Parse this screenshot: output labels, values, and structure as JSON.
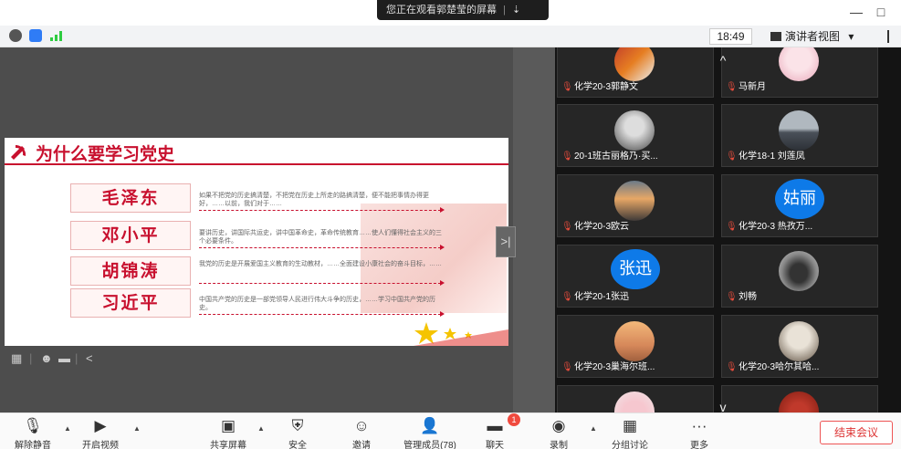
{
  "titlebar": {
    "banner_text": "您正在观看郭楚莹的屏幕",
    "banner_sep": "|",
    "banner_more": "⇣",
    "minimize": "—",
    "maximize": "□"
  },
  "statusbar": {
    "time": "18:49",
    "view_mode": "演讲者视图",
    "view_caret": "▾"
  },
  "slide": {
    "title": "为什么要学习党史",
    "leaders": [
      {
        "name": "毛泽东",
        "desc": "如果不把党的历史搞清楚，不把党在历史上所走的路搞清楚，便不能把事情办得更好，……以前，我们对于……"
      },
      {
        "name": "邓小平",
        "desc": "要讲历史，讲国际共运史，讲中国革命史，革命传统教育……使人们懂得社会主义的三个必要条件。"
      },
      {
        "name": "胡锦涛",
        "desc": "我党的历史是开展爱国主义教育的生动教材，……全面建设小康社会的奋斗目标，……"
      },
      {
        "name": "习近平",
        "desc": "中国共产党的历史是一部党领导人民进行伟大斗争的历史，……学习中国共产党的历史。"
      }
    ]
  },
  "share_toolbar": {
    "items": [
      "layout-icon",
      "emoji-icon",
      "chat-icon"
    ],
    "sep": "|",
    "back": "<"
  },
  "gallery": {
    "collapse": ">|",
    "scroll_up": "^",
    "scroll_down": "v",
    "tiles": [
      {
        "name": "化学20-3郭静文",
        "kind": "photo"
      },
      {
        "name": "马新月",
        "kind": "photo"
      },
      {
        "name": "20-1班古丽格乃·买...",
        "kind": "photo"
      },
      {
        "name": "化学18-1 刘莲凤",
        "kind": "photo"
      },
      {
        "name": "化学20-3欧云",
        "kind": "photo"
      },
      {
        "name": "化学20-3 热孜万...",
        "kind": "avatar",
        "avatar": "姑丽"
      },
      {
        "name": "化学20-1张迅",
        "kind": "avatar",
        "avatar": "张迅"
      },
      {
        "name": "刘畅",
        "kind": "photo"
      },
      {
        "name": "化学20-3巢海尔班...",
        "kind": "photo"
      },
      {
        "name": "化学20-3哈尔其哈...",
        "kind": "photo"
      },
      {
        "name": "",
        "kind": "photo"
      },
      {
        "name": "",
        "kind": "photo"
      }
    ]
  },
  "controls": {
    "unmute": "解除静音",
    "video": "开启视频",
    "share": "共享屏幕",
    "security": "安全",
    "invite": "邀请",
    "participants": "管理成员(78)",
    "chat": "聊天",
    "chat_badge": "1",
    "record": "录制",
    "breakout": "分组讨论",
    "more": "更多",
    "end": "结束会议"
  },
  "colors": {
    "accent_red": "#c8102e",
    "avatar_blue": "#0e7ae8",
    "end_red": "#d33333"
  }
}
